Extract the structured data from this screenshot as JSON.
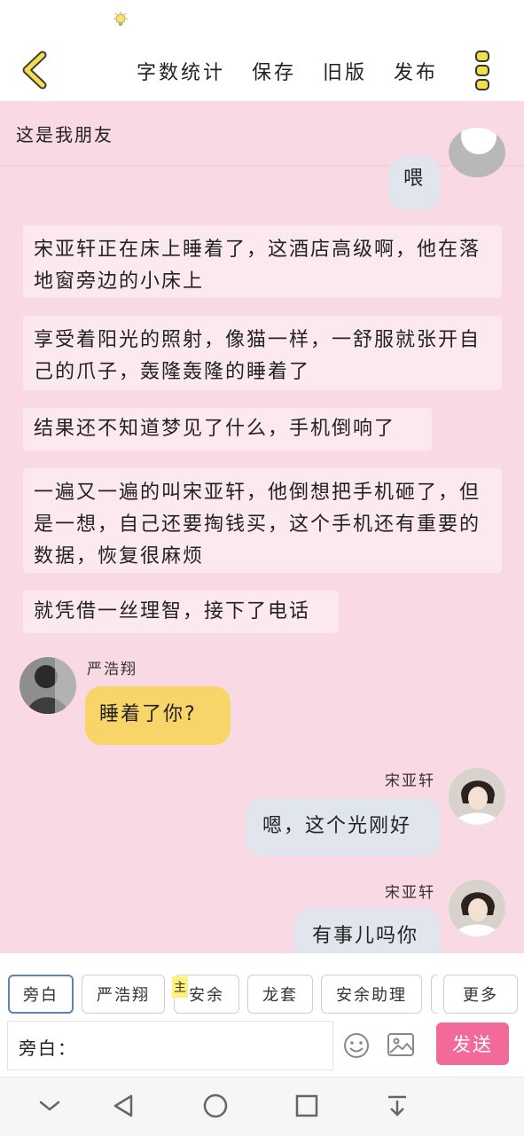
{
  "header": {
    "menu": [
      {
        "label": "字数统计"
      },
      {
        "label": "保存"
      },
      {
        "label": "旧版"
      },
      {
        "label": "发布"
      }
    ]
  },
  "chat": {
    "title": "这是我朋友",
    "messages": [
      {
        "text": "喂"
      },
      {
        "text": "宋亚轩正在床上睡着了，这酒店高级啊，他在落地窗旁边的小床上"
      },
      {
        "text": "享受着阳光的照射，像猫一样，一舒服就张开自己的爪子，轰隆轰隆的睡着了"
      },
      {
        "text": "结果还不知道梦见了什么，手机倒响了"
      },
      {
        "text": "一遍又一遍的叫宋亚轩，他倒想把手机砸了，但是一想，自己还要掏钱买，这个手机还有重要的数据，恢复很麻烦"
      },
      {
        "text": "就凭借一丝理智，接下了电话"
      },
      {
        "speaker": "严浩翔",
        "text": "睡着了你?"
      },
      {
        "speaker": "宋亚轩",
        "text": "嗯，这个光刚好"
      },
      {
        "speaker": "宋亚轩",
        "text": "有事儿吗你"
      }
    ]
  },
  "toolbar": {
    "roles": [
      {
        "label": "旁白"
      },
      {
        "label": "严浩翔"
      },
      {
        "label": "安余"
      },
      {
        "label": "龙套"
      },
      {
        "label": "安余助理"
      }
    ],
    "main_tag": "主",
    "more_label": "更多",
    "input_label": "旁白：",
    "send_label": "发送"
  },
  "colors": {
    "chat_bg": "#f9d9e3",
    "narration_bubble": "#fbe9ef",
    "right_bubble": "#e0e5ee",
    "left_bubble": "#f8d568",
    "send_button": "#f26a99",
    "selected_border": "#5b83c2",
    "accent_yellow": "#f2df4a"
  },
  "icons": [
    "lightbulb-icon",
    "back-chevron-icon",
    "more-dots-icon",
    "emoji-icon",
    "image-icon",
    "nav-hide-icon",
    "nav-back-icon",
    "nav-home-icon",
    "nav-recents-icon",
    "nav-pull-down-icon"
  ]
}
